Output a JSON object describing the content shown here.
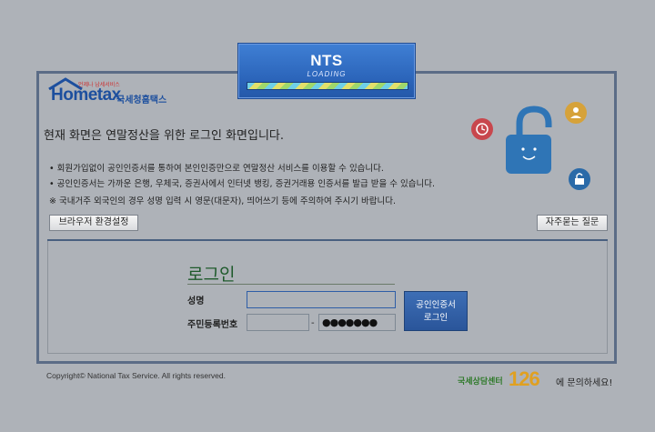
{
  "loading": {
    "brand": "NTS",
    "status": "LOADING"
  },
  "logo": {
    "tagline": "언제나 납세서비스",
    "wordmark": "Hometax",
    "name_kr": "국세청홈택스"
  },
  "heading": "현재 화면은 연말정산을 위한 로그인 화면입니다.",
  "notes": [
    "회원가입없이 공인인증서를 통하여 본인인증만으로 연말정산 서비스를 이용할 수 있습니다.",
    "공인인증서는 가까운 은행, 우체국, 증권사에서 인터넷 뱅킹, 증권거래용 인증서를 발급 받을 수 있습니다.",
    "※ 국내거주 외국인의 경우 성명 입력 시 영문(대문자), 띄어쓰기 등에 주의하여 주시기 바랍니다."
  ],
  "buttons": {
    "browser_settings": "브라우저 환경설정",
    "faq": "자주묻는 질문"
  },
  "login": {
    "title": "로그인",
    "name_label": "성명",
    "name_value": "",
    "rrn_label": "주민등록번호",
    "rrn_front": "",
    "rrn_separator": "-",
    "rrn_back_masked": "●●●●●●●",
    "cert_button": "공인인증서\n로그인"
  },
  "footer": {
    "copyright": "Copyright© National Tax Service. All rights reserved.",
    "call_prefix": "국세상담센터",
    "call_number": "126",
    "call_suffix": "에 문의하세요!"
  },
  "colors": {
    "background": "#aeb2b8",
    "brand_blue": "#1d4f9e",
    "panel_border": "#5b6c86",
    "login_green": "#1e5a2b"
  }
}
